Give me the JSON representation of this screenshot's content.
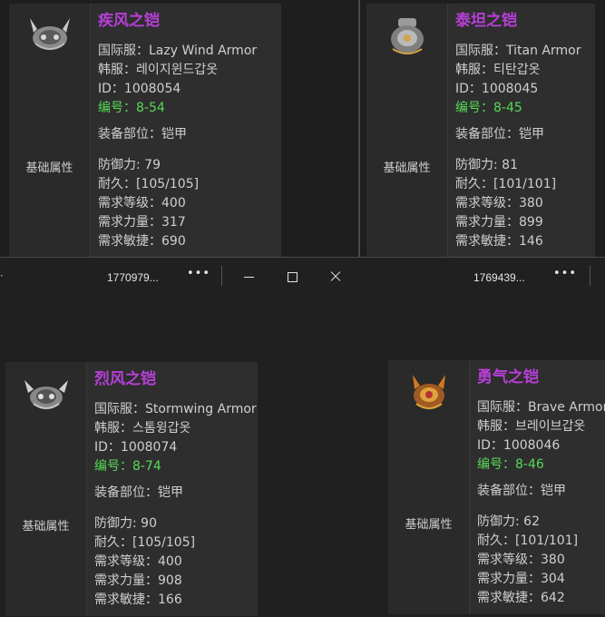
{
  "windows": [
    {
      "title": "1770979...",
      "more_icon": "more-horizontal-icon"
    },
    {
      "title": "1769439...",
      "more_icon": "more-horizontal-icon"
    }
  ],
  "cards": [
    {
      "name": "疾风之铠",
      "intl_line": "国际服：Lazy Wind Armor",
      "kr_line": "韩服：레이지윈드갑옷",
      "id_line": "ID：1008054",
      "code_line": "编号：8-54",
      "slot_line": "装备部位：铠甲",
      "section_label": "基础属性",
      "stats": [
        "防御力: 79",
        "耐久：[105/105]",
        "需求等级：400",
        "需求力量：317",
        "需求敏捷：690"
      ],
      "icon": "armor-icon"
    },
    {
      "name": "泰坦之铠",
      "intl_line": "国际服：Titan Armor",
      "kr_line": "韩服：티탄갑옷",
      "id_line": "ID：1008045",
      "code_line": "编号：8-45",
      "slot_line": "装备部位：铠甲",
      "section_label": "基础属性",
      "stats": [
        "防御力: 81",
        "耐久：[101/101]",
        "需求等级：380",
        "需求力量：899",
        "需求敏捷：146"
      ],
      "icon": "armor-icon"
    },
    {
      "name": "烈风之铠",
      "intl_line": "国际服：Stormwing Armor",
      "kr_line": "韩服：스톰윙갑옷",
      "id_line": "ID：1008074",
      "code_line": "编号：8-74",
      "slot_line": "装备部位：铠甲",
      "section_label": "基础属性",
      "stats": [
        "防御力: 90",
        "耐久：[105/105]",
        "需求等级：400",
        "需求力量：908",
        "需求敏捷：166"
      ],
      "icon": "armor-icon"
    },
    {
      "name": "勇气之铠",
      "intl_line": "国际服：Brave Armor",
      "kr_line": "韩服：브레이브갑옷",
      "id_line": "ID：1008046",
      "code_line": "编号：8-46",
      "slot_line": "装备部位：铠甲",
      "section_label": "基础属性",
      "stats": [
        "防御力: 62",
        "耐久：[101/101]",
        "需求等级：380",
        "需求力量：304",
        "需求敏捷：642"
      ],
      "icon": "armor-icon"
    }
  ],
  "colors": {
    "name": "#b73fd8",
    "code": "#57d957",
    "panel": "#2e2e2e"
  }
}
